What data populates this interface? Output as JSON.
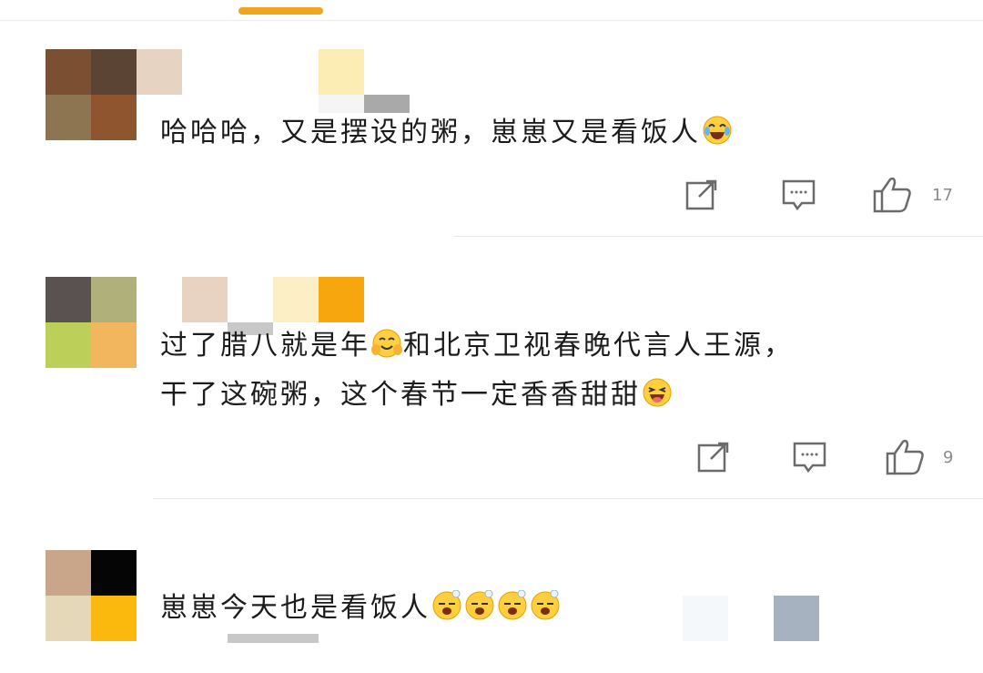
{
  "colors": {
    "accent": "#f0a51e",
    "icon": "#6b6b6b",
    "divider": "#e8e8e8"
  },
  "comments": [
    {
      "text": "哈哈哈，又是摆设的粥，崽崽又是看饭人",
      "emoji": "laughing-tears",
      "likes": "17"
    },
    {
      "line1": "过了腊八就是年",
      "line1b": "和北京卫视春晚代言人王源，",
      "line2": "干了这碗粥，这个春节一定香香甜甜",
      "emoji_mid": "blushing-hands",
      "emoji_end": "yummy",
      "likes": "9"
    },
    {
      "text": "崽崽今天也是看饭人",
      "emoji": "sleepy-face"
    }
  ],
  "icons": {
    "share": "share-icon",
    "reply": "comment-icon",
    "like": "thumbs-up-icon"
  }
}
